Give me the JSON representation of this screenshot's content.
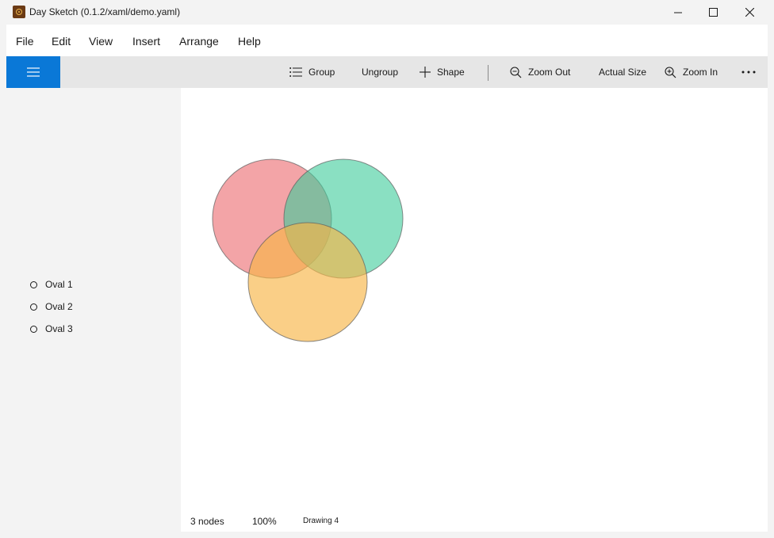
{
  "window": {
    "title": "Day Sketch (0.1.2/xaml/demo.yaml)"
  },
  "menu": [
    {
      "label": "File"
    },
    {
      "label": "Edit"
    },
    {
      "label": "View"
    },
    {
      "label": "Insert"
    },
    {
      "label": "Arrange"
    },
    {
      "label": "Help"
    }
  ],
  "toolbar": {
    "group_label": "Group",
    "ungroup_label": "Ungroup",
    "shape_label": "Shape",
    "zoom_out_label": "Zoom Out",
    "actual_size_label": "Actual Size",
    "zoom_in_label": "Zoom In"
  },
  "layers": [
    {
      "label": "Oval 1"
    },
    {
      "label": "Oval 2"
    },
    {
      "label": "Oval 3"
    }
  ],
  "status": {
    "nodes": "3 nodes",
    "zoom": "100%",
    "drawing": "Drawing 4"
  },
  "colors": {
    "accent": "#0a78d7",
    "oval1": "#f08a8e",
    "oval2": "#3ccc9a",
    "oval3": "#f8b546"
  }
}
